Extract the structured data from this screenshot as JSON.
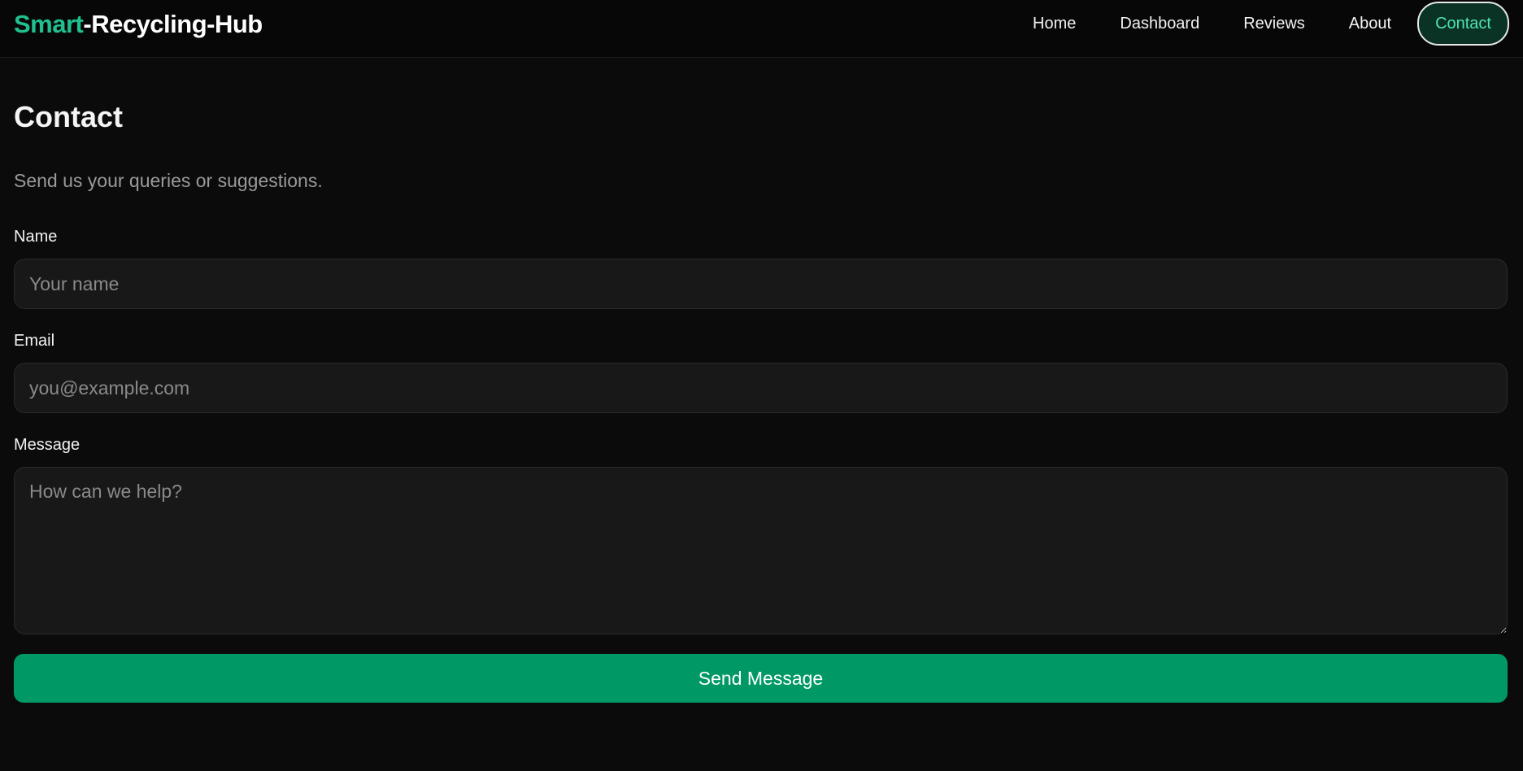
{
  "brand": {
    "accent": "Smart",
    "rest": "-Recycling-Hub"
  },
  "nav": {
    "items": [
      "Home",
      "Dashboard",
      "Reviews",
      "About",
      "Contact"
    ],
    "active": "Contact"
  },
  "page": {
    "title": "Contact",
    "subtitle": "Send us your queries or suggestions."
  },
  "form": {
    "name_label": "Name",
    "name_placeholder": "Your name",
    "name_value": "",
    "email_label": "Email",
    "email_placeholder": "you@example.com",
    "email_value": "",
    "message_label": "Message",
    "message_placeholder": "How can we help?",
    "message_value": "",
    "submit_label": "Send Message"
  },
  "colors": {
    "accent": "#1fc08f",
    "button": "#009966",
    "background": "#0b0b0b"
  }
}
